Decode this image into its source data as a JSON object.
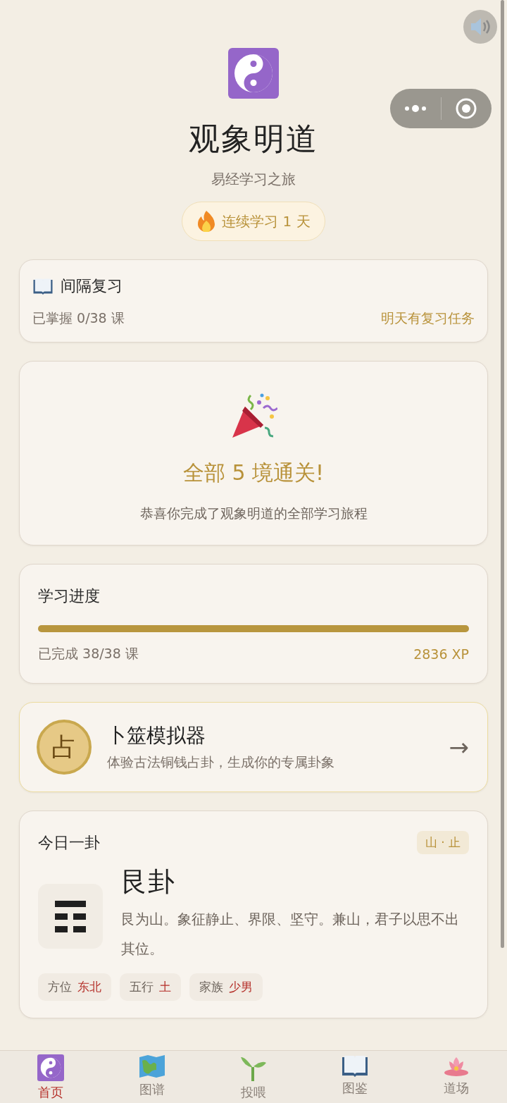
{
  "header": {
    "title": "观象明道",
    "subtitle": "易经学习之旅",
    "streak": "连续学习 1 天"
  },
  "review": {
    "title": "间隔复习",
    "mastered": "已掌握 0/38 课",
    "status": "明天有复习任务"
  },
  "celebration": {
    "title": "全部 5 境通关!",
    "message": "恭喜你完成了观象明道的全部学习旅程"
  },
  "progress": {
    "title": "学习进度",
    "level": 1,
    "completed": "已完成 38/38 课",
    "xp": "2836 XP"
  },
  "simulator": {
    "badge": "占",
    "title": "卜筮模拟器",
    "description": "体验古法铜钱占卦，生成你的专属卦象",
    "arrow": "→"
  },
  "daily": {
    "title": "今日一卦",
    "tag": "山 · 止",
    "name": "艮卦",
    "lines": [
      {
        "kind": "solid"
      },
      {
        "kind": "broken"
      },
      {
        "kind": "broken"
      }
    ],
    "description": "艮为山。象征静止、界限、坚守。兼山，君子以思不出其位。",
    "facts": [
      {
        "label": "方位",
        "value": "东北"
      },
      {
        "label": "五行",
        "value": "土"
      },
      {
        "label": "家族",
        "value": "少男"
      }
    ]
  },
  "tabs": [
    {
      "label": "首页",
      "selected": true
    },
    {
      "label": "图谱",
      "selected": false
    },
    {
      "label": "投喂",
      "selected": false
    },
    {
      "label": "图鉴",
      "selected": false
    },
    {
      "label": "道场",
      "selected": false
    }
  ]
}
